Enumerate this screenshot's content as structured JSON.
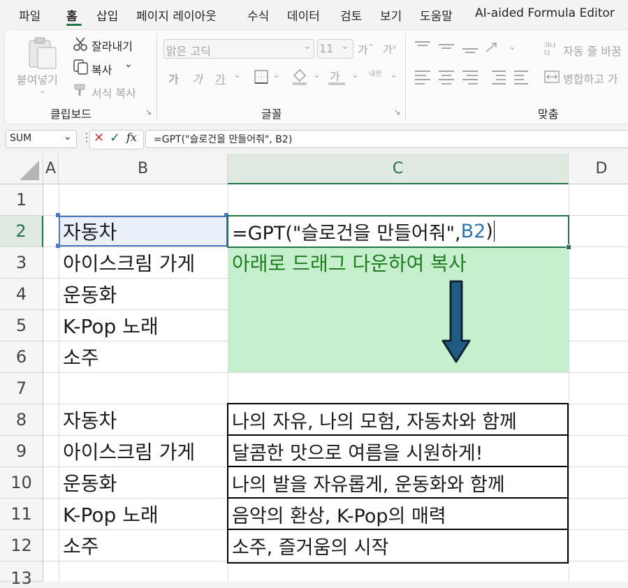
{
  "menu": {
    "tabs": [
      "파일",
      "홈",
      "삽입",
      "페이지 레이아웃",
      "수식",
      "데이터",
      "검토",
      "보기",
      "도움말",
      "AI-aided Formula Editor"
    ],
    "active": "홈"
  },
  "ribbon": {
    "clipboard": {
      "paste": "붙여넣기",
      "cut": "잘라내기",
      "copy": "복사",
      "format_painter": "서식 복사",
      "label": "클립보드"
    },
    "font": {
      "font_name": "맑은 고딕",
      "font_size": "11",
      "bold": "가",
      "italic": "가",
      "underline": "가",
      "font_color": "가",
      "phonetic": "내천",
      "label": "글꼴"
    },
    "alignment": {
      "wrap": "자동 줄 바꿈",
      "merge": "병합하고 가",
      "label": "맞춤"
    }
  },
  "formula_bar": {
    "name_box": "SUM",
    "fx": "fx",
    "formula": "=GPT(\"슬로건을 만들어줘\", B2)"
  },
  "sheet": {
    "columns": [
      "A",
      "B",
      "C",
      "D"
    ],
    "rows": [
      "1",
      "2",
      "3",
      "4",
      "5",
      "6",
      "7",
      "8",
      "9",
      "10",
      "11",
      "12",
      "13"
    ],
    "active_cell": "C2",
    "cells": {
      "B2": "자동차",
      "B3": "아이스크림 가게",
      "B4": "운동화",
      "B5": "K-Pop 노래",
      "B6": "소주",
      "C2_prefix": "=GPT(\"슬로건을 만들어줘\", ",
      "C2_ref": "B2",
      "C2_suffix": ")",
      "C3": "아래로 드래그 다운하여 복사",
      "B8": "자동차",
      "B9": "아이스크림 가게",
      "B10": "운동화",
      "B11": "K-Pop 노래",
      "B12": "소주",
      "C8": "나의 자유, 나의 모험, 자동차와 함께",
      "C9": "달콤한 맛으로 여름을 시원하게!",
      "C10": "나의 발을 자유롭게, 운동화와 함께",
      "C11": "음악의 환상, K-Pop의 매력",
      "C12": "소주, 즐거움의 시작"
    }
  },
  "colors": {
    "accent": "#217346",
    "note_fill": "#c6efce",
    "note_text": "#1e7b1e",
    "ref_blue": "#2e75b6",
    "arrow": "#1f5c80"
  }
}
